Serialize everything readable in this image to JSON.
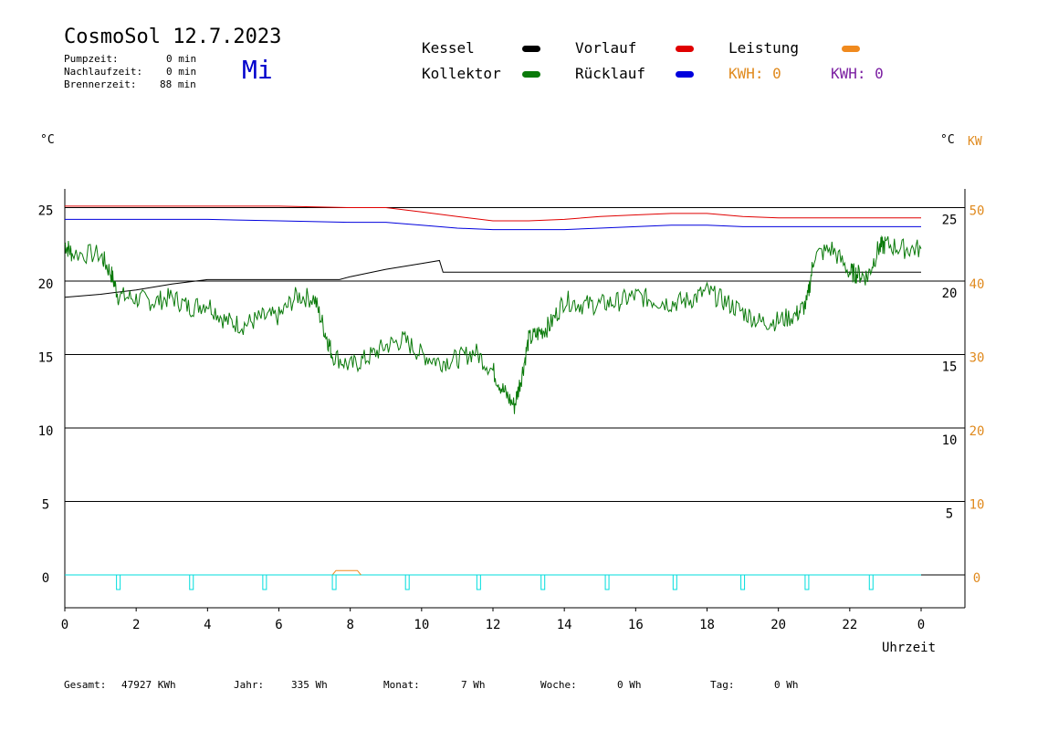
{
  "header": {
    "title": "CosmoSol 12.7.2023",
    "day": "Mi",
    "stats": [
      {
        "label": "Pumpzeit:",
        "value": "0 min"
      },
      {
        "label": "Nachlaufzeit:",
        "value": "0 min"
      },
      {
        "label": "Brennerzeit:",
        "value": "88 min"
      }
    ]
  },
  "legend": {
    "kessel": {
      "label": "Kessel",
      "color": "#000000"
    },
    "vorlauf": {
      "label": "Vorlauf",
      "color": "#e00000"
    },
    "leistung": {
      "label": "Leistung",
      "color": "#f08a1e"
    },
    "kollektor": {
      "label": "Kollektor",
      "color": "#0a7a0a"
    },
    "ruecklauf": {
      "label": "Rücklauf",
      "color": "#0000dd"
    },
    "kwh1": "KWH: 0",
    "kwh2": "KWH: 0"
  },
  "axes": {
    "left_unit": "°C",
    "right_unit_c": "°C",
    "right_unit_kw": "KW",
    "xlabel": "Uhrzeit"
  },
  "footer": [
    {
      "label": "Gesamt:",
      "value": "47927 KWh"
    },
    {
      "label": "Jahr:",
      "value": "335 Wh"
    },
    {
      "label": "Monat:",
      "value": "7 Wh"
    },
    {
      "label": "Woche:",
      "value": "0 Wh"
    },
    {
      "label": "Tag:",
      "value": "0 Wh"
    }
  ],
  "chart_data": {
    "type": "line",
    "title": "CosmoSol 12.7.2023",
    "xlabel": "Uhrzeit",
    "ylabel": "°C",
    "xlim": [
      0,
      24
    ],
    "ylim": [
      0,
      25
    ],
    "x_ticks": [
      "0",
      "2",
      "4",
      "6",
      "8",
      "10",
      "12",
      "14",
      "16",
      "18",
      "20",
      "22",
      "0"
    ],
    "y_ticks_left": [
      "0",
      "5",
      "10",
      "15",
      "20",
      "25"
    ],
    "y_ticks_right_c": [
      "5",
      "10",
      "15",
      "20",
      "25"
    ],
    "y_ticks_right_kw": [
      "0",
      "10",
      "20",
      "30",
      "40",
      "50"
    ],
    "grid": true,
    "series": [
      {
        "name": "Vorlauf",
        "color": "#e00000",
        "x": [
          0,
          2,
          4,
          6,
          8,
          9,
          10,
          11,
          12,
          13,
          14,
          15,
          16,
          17,
          18,
          19,
          20,
          21,
          22,
          23,
          24
        ],
        "y": [
          25.1,
          25.1,
          25.1,
          25.1,
          25.0,
          25.0,
          24.7,
          24.4,
          24.1,
          24.1,
          24.2,
          24.4,
          24.5,
          24.6,
          24.6,
          24.4,
          24.3,
          24.3,
          24.3,
          24.3,
          24.3
        ]
      },
      {
        "name": "Rücklauf",
        "color": "#0000dd",
        "x": [
          0,
          2,
          4,
          6,
          8,
          9,
          10,
          11,
          12,
          13,
          14,
          15,
          16,
          17,
          18,
          19,
          20,
          21,
          22,
          23,
          24
        ],
        "y": [
          24.2,
          24.2,
          24.2,
          24.1,
          24.0,
          24.0,
          23.8,
          23.6,
          23.5,
          23.5,
          23.5,
          23.6,
          23.7,
          23.8,
          23.8,
          23.7,
          23.7,
          23.7,
          23.7,
          23.7,
          23.7
        ]
      },
      {
        "name": "Kessel",
        "x": [
          0,
          1,
          2,
          3,
          4,
          7.7,
          8,
          9,
          10,
          10.5,
          10.6,
          24
        ],
        "y": [
          18.9,
          19.1,
          19.4,
          19.8,
          20.1,
          20.1,
          20.3,
          20.8,
          21.2,
          21.4,
          20.6,
          20.6
        ]
      },
      {
        "name": "Kollektor",
        "x": [
          0,
          0.2,
          1,
          1.3,
          1.5,
          2,
          2.5,
          3,
          3.5,
          4,
          4.5,
          5,
          5.5,
          6,
          6.5,
          7,
          7.3,
          7.5,
          8,
          8.5,
          9,
          9.5,
          10,
          10.5,
          11,
          11.5,
          12,
          12.3,
          12.6,
          12.8,
          13,
          13.3,
          13.6,
          14,
          14.5,
          15,
          15.5,
          16,
          16.5,
          17,
          17.5,
          18,
          18.5,
          19,
          19.5,
          20,
          20.5,
          20.8,
          21,
          21.5,
          22,
          22.2,
          22.5,
          22.8,
          23,
          23.5,
          24
        ],
        "y": [
          22.5,
          21.9,
          21.8,
          20.5,
          19.0,
          18.8,
          18.6,
          18.9,
          18.2,
          18.5,
          17.3,
          17.0,
          17.5,
          17.6,
          19.0,
          18.8,
          16.5,
          15.0,
          14.2,
          14.8,
          15.6,
          16.0,
          15.0,
          14.5,
          14.7,
          15.2,
          13.9,
          12.5,
          11.5,
          13.5,
          16.0,
          16.5,
          17.0,
          18.7,
          18.4,
          18.4,
          18.6,
          19.0,
          18.7,
          18.5,
          18.7,
          19.3,
          18.6,
          17.9,
          17.2,
          17.3,
          17.7,
          18.5,
          21.7,
          22.2,
          20.6,
          20.5,
          20.3,
          22.2,
          22.5,
          22.2,
          22.2
        ]
      },
      {
        "name": "Leistung",
        "color": "#f08a1e",
        "axis": "kw",
        "x": [
          7.5,
          7.6,
          8.2,
          8.3
        ],
        "y": [
          0,
          0.3,
          0.3,
          0
        ]
      },
      {
        "name": "Pumpe",
        "color": "#00dddd",
        "axis": "kw",
        "x": [
          1.5,
          3.55,
          5.6,
          7.55,
          9.6,
          11.6,
          13.4,
          15.2,
          17.1,
          19.0,
          20.8,
          22.6
        ],
        "y": [
          0,
          0,
          0,
          0,
          0,
          0,
          0,
          0,
          0,
          0,
          0,
          0
        ]
      }
    ]
  }
}
